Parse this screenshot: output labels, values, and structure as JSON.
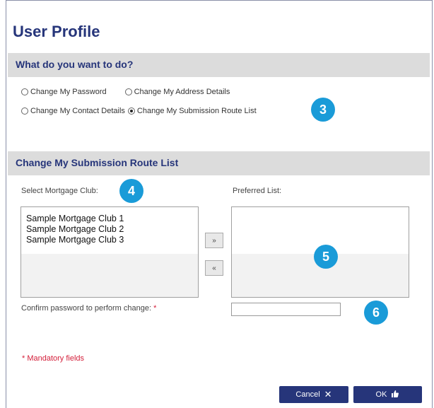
{
  "title": "User Profile",
  "section1": {
    "heading": "What do you want to do?",
    "options": [
      {
        "label": "Change My Password",
        "selected": false
      },
      {
        "label": "Change My Address Details",
        "selected": false
      },
      {
        "label": "Change My Contact Details",
        "selected": false
      },
      {
        "label": "Change My Submission Route List",
        "selected": true
      }
    ]
  },
  "badges": [
    "3",
    "4",
    "5",
    "6"
  ],
  "section2": {
    "heading": "Change My Submission Route List",
    "select_label": "Select Mortgage Club:",
    "preferred_label": "Preferred List:",
    "clubs": [
      "Sample Mortgage Club 1",
      "Sample Mortgage Club 2",
      "Sample Mortgage Club 3"
    ],
    "add_btn": "»",
    "remove_btn": "«",
    "confirm_label": "Confirm password to perform change:",
    "required_mark": "*",
    "password_value": ""
  },
  "mandatory_note": "* Mandatory fields",
  "buttons": {
    "cancel": "Cancel",
    "ok": "OK"
  },
  "colors": {
    "accent": "#26357a",
    "badge": "#1a9bd8",
    "required": "#d4203b",
    "section_bg": "#dcdcdc"
  }
}
